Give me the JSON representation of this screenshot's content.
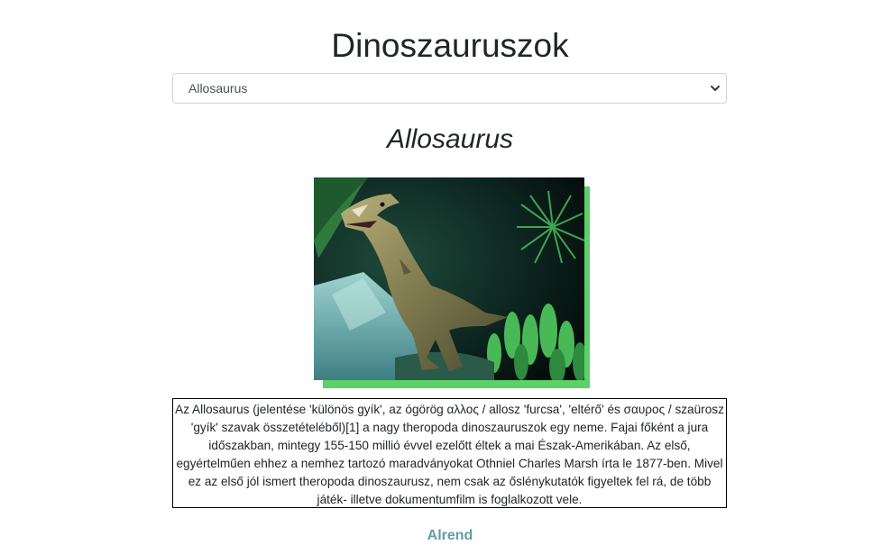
{
  "page": {
    "title": "Dinoszauruszok"
  },
  "selector": {
    "selected_value": "Allosaurus"
  },
  "dinosaur": {
    "name": "Allosaurus",
    "image_subject": "allosaurus-photo",
    "description": "Az Allosaurus (jelentése 'különös gyík', az ógörög αλλος / allosz 'furcsa', 'eltérő' és σαυρος / szaürosz 'gyík' szavak összetételéből)[1] a nagy theropoda dinoszauruszok egy neme. Fajai főként a jura időszakban, mintegy 155-150 millió évvel ezelőtt éltek a mai Észak-Amerikában. Az első, egyértelműen ehhez a nemhez tartozó maradványokat Othniel Charles Marsh írta le 1877-ben. Mivel ez az első jól ismert theropoda dinoszaurusz, nem csak az őslénykutatók figyeltek fel rá, de több játék- illetve dokumentumfilm is foglalkozott vele."
  },
  "footer": {
    "link_label": "Alrend"
  },
  "colors": {
    "image_shadow": "#5cd16a",
    "link": "#5f9ea0",
    "border": "#ced4da"
  }
}
